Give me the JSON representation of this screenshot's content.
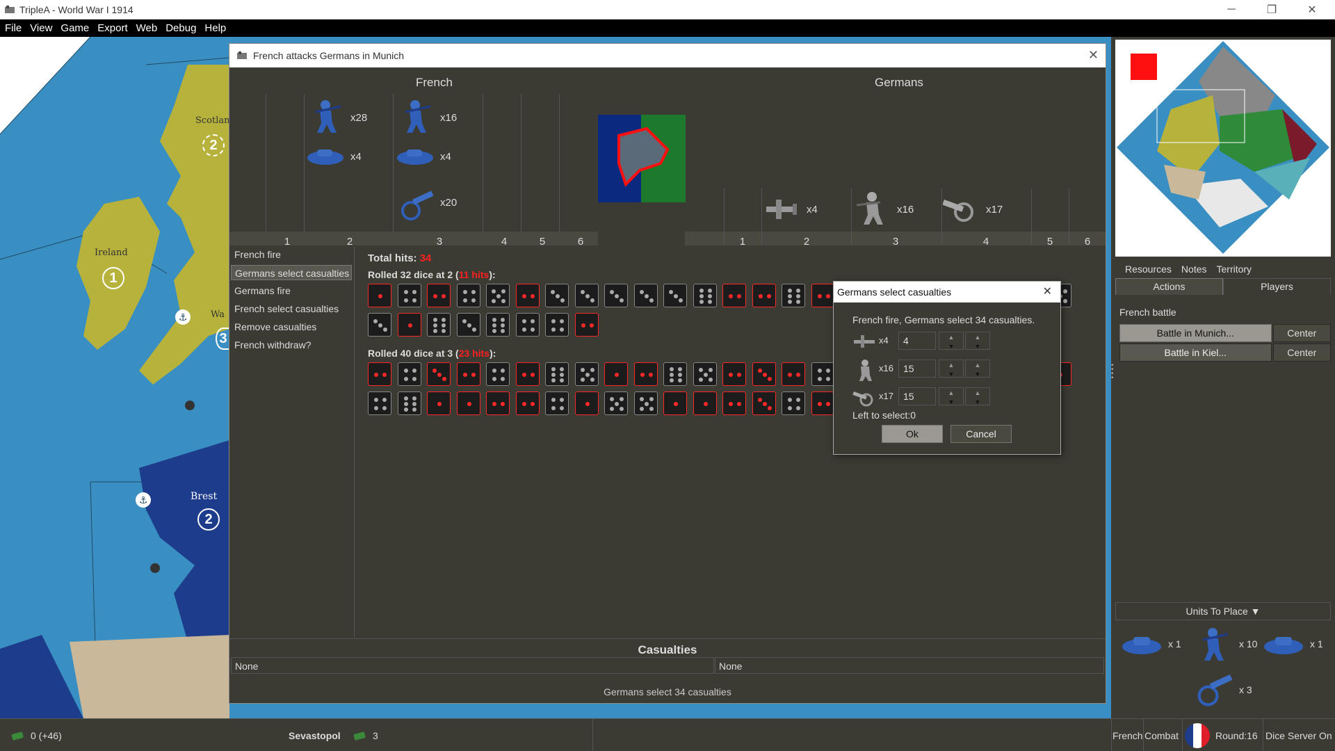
{
  "window": {
    "title": "TripleA - World War I 1914"
  },
  "menu": [
    {
      "label": "File"
    },
    {
      "label": "View"
    },
    {
      "label": "Game"
    },
    {
      "label": "Export"
    },
    {
      "label": "Web"
    },
    {
      "label": "Debug"
    },
    {
      "label": "Help"
    }
  ],
  "map": {
    "territories": [
      {
        "name": "Scotland",
        "value": "2"
      },
      {
        "name": "Ireland",
        "value": "1"
      },
      {
        "name": "Wa",
        "value": "3"
      },
      {
        "name": "Brest",
        "value": "2"
      }
    ]
  },
  "battle": {
    "title": "French attacks Germans in Munich",
    "attacker": "French",
    "defender": "Germans",
    "attacker_columns": [
      "1",
      "2",
      "3",
      "4",
      "5",
      "6"
    ],
    "defender_columns": [
      "1",
      "2",
      "3",
      "4",
      "5",
      "6"
    ],
    "attacker_units": [
      {
        "icon": "infantry-icon",
        "count": "x28"
      },
      {
        "icon": "tank-icon",
        "count": "x4"
      },
      {
        "icon": "infantry-icon",
        "count": "x16"
      },
      {
        "icon": "tank-icon",
        "count": "x4"
      },
      {
        "icon": "artillery-icon",
        "count": "x20"
      }
    ],
    "defender_units": [
      {
        "icon": "fighter-icon",
        "count": "x4"
      },
      {
        "icon": "infantry-icon",
        "count": "x16"
      },
      {
        "icon": "artillery-icon",
        "count": "x17"
      }
    ],
    "steps": [
      {
        "label": "French fire"
      },
      {
        "label": "Germans select casualties"
      },
      {
        "label": "Germans fire"
      },
      {
        "label": "French select casualties"
      },
      {
        "label": "Remove casualties"
      },
      {
        "label": "French withdraw?"
      }
    ],
    "active_step": 1,
    "total_hits_label": "Total hits:",
    "total_hits": "34",
    "roll1": {
      "prefix": "Rolled 32 dice at 2 (",
      "hits": "11 hits",
      "suffix": "):",
      "dice": [
        1,
        4,
        2,
        4,
        5,
        2,
        3,
        3,
        3,
        3,
        3,
        6,
        2,
        2,
        6,
        2,
        3,
        3,
        3,
        3,
        3,
        6,
        3,
        5,
        3,
        1,
        6,
        3,
        6,
        4,
        4,
        2
      ]
    },
    "roll2": {
      "prefix": "Rolled 40 dice at 3 (",
      "hits": "23 hits",
      "suffix": "):",
      "dice": [
        2,
        4,
        3,
        2,
        4,
        2,
        6,
        5,
        1,
        2,
        6,
        5,
        2,
        3,
        2,
        4,
        2,
        2,
        1,
        2,
        3,
        6,
        4,
        1,
        4,
        6,
        1,
        1,
        2,
        2,
        4,
        1,
        5,
        5,
        1,
        1,
        2,
        3,
        4,
        2
      ]
    },
    "casualties_title": "Casualties",
    "casualties_attacker": "None",
    "casualties_defender": "None",
    "status": "Germans select 34 casualties"
  },
  "dialog": {
    "title": "Germans select casualties",
    "message": "French fire,  Germans select 34 casualties.",
    "rows": [
      {
        "icon": "fighter-icon",
        "count": "x4",
        "value": "4"
      },
      {
        "icon": "infantry-icon",
        "count": "x16",
        "value": "15"
      },
      {
        "icon": "artillery-icon",
        "count": "x17",
        "value": "15"
      }
    ],
    "left_to_select": "Left to select:0",
    "ok": "Ok",
    "cancel": "Cancel"
  },
  "sidepanel": {
    "tabs_row1": [
      "Resources",
      "Notes",
      "Territory"
    ],
    "tabs_row2": [
      "Actions",
      "Players"
    ],
    "active_tab": "Actions",
    "battle_heading": "French battle",
    "battles": [
      {
        "label": "Battle in Munich...",
        "center": "Center"
      },
      {
        "label": "Battle in Kiel...",
        "center": "Center"
      }
    ],
    "units_to_place": "Units To Place ▼",
    "place_units": [
      {
        "icon": "tank-icon",
        "count": "x 1"
      },
      {
        "icon": "infantry-icon",
        "count": "x 10"
      },
      {
        "icon": "tank-icon",
        "count": "x 1"
      },
      {
        "icon": "artillery-icon",
        "count": "x 3"
      }
    ]
  },
  "statusbar": {
    "money": "0 (+46)",
    "territory": "Sevastopol",
    "territory_value": "3",
    "player": "French",
    "phase": "Combat",
    "round": "Round:16",
    "dice": "Dice Server On"
  },
  "colors": {
    "hit": "#ff2828",
    "panel": "#3b3a33",
    "french": "#1e3c8c",
    "british": "#b6b23c",
    "sea": "#3a8fc2"
  }
}
